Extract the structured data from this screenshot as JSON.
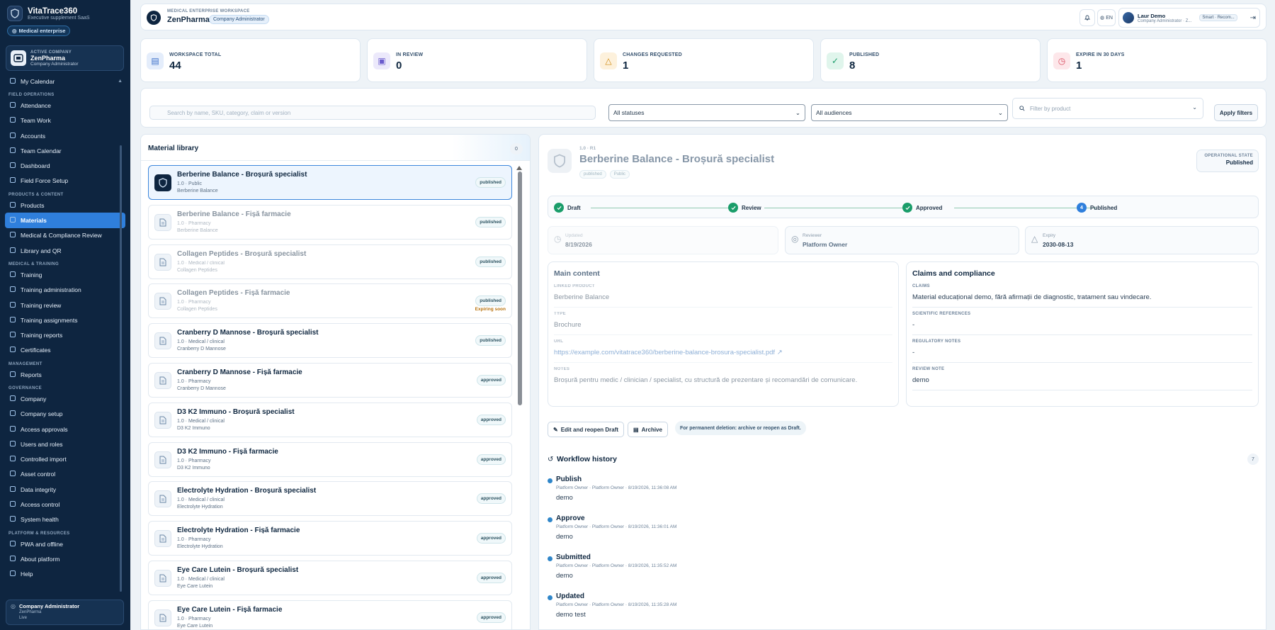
{
  "brand": {
    "name": "VitaTrace360",
    "sub": "Executive supplement SaaS",
    "tag": "Medical enterprise"
  },
  "company_card": {
    "kicker": "ACTIVE COMPANY",
    "name": "ZenPharma",
    "role": "Company Administrator"
  },
  "nav": {
    "top": [
      {
        "label": "My Calendar"
      }
    ],
    "sections": [
      {
        "title": "FIELD OPERATIONS",
        "items": [
          "Attendance",
          "Team Work",
          "Accounts",
          "Team Calendar",
          "Dashboard",
          "Field Force Setup"
        ]
      },
      {
        "title": "PRODUCTS & CONTENT",
        "items": [
          "Products",
          "Materials",
          "Medical & Compliance Review",
          "Library and QR"
        ]
      },
      {
        "title": "MEDICAL & TRAINING",
        "items": [
          "Training",
          "Training administration",
          "Training review",
          "Training assignments",
          "Training reports",
          "Certificates"
        ]
      },
      {
        "title": "MANAGEMENT",
        "items": [
          "Reports"
        ]
      },
      {
        "title": "GOVERNANCE",
        "items": [
          "Company",
          "Company setup",
          "Access approvals",
          "Users and roles",
          "Controlled import",
          "Asset control",
          "Data integrity",
          "Access control",
          "System health"
        ]
      },
      {
        "title": "PLATFORM & RESOURCES",
        "items": [
          "PWA and offline",
          "About platform",
          "Help"
        ]
      }
    ],
    "active": "Materials"
  },
  "sidebar_footer": {
    "title": "Company Administrator",
    "company": "ZenPharma",
    "status": "Live"
  },
  "topbar": {
    "kicker": "MEDICAL ENTERPRISE WORKSPACE",
    "name": "ZenPharma",
    "role": "Company Administrator",
    "lang": "EN",
    "user_name": "Laur Demo",
    "user_role": "Company Administrator · Z...",
    "user_chip": "Smart · Recom..."
  },
  "stats": [
    {
      "label": "WORKSPACE TOTAL",
      "value": "44",
      "color": "#e4edfb",
      "fg": "#3b6fc9"
    },
    {
      "label": "IN REVIEW",
      "value": "0",
      "color": "#ece9fb",
      "fg": "#6a5acd"
    },
    {
      "label": "CHANGES REQUESTED",
      "value": "1",
      "color": "#fdf1dc",
      "fg": "#d08a12"
    },
    {
      "label": "PUBLISHED",
      "value": "8",
      "color": "#e0f5ec",
      "fg": "#1a9d6a"
    },
    {
      "label": "EXPIRE IN 30 DAYS",
      "value": "1",
      "color": "#fde7ea",
      "fg": "#d84b5e"
    }
  ],
  "filters": {
    "search_placeholder": "Search by name, SKU, category, claim or version",
    "status": "All statuses",
    "audience": "All audiences",
    "product_placeholder": "Filter by product",
    "apply": "Apply filters"
  },
  "library": {
    "title": "Material library",
    "count": "0",
    "items": [
      {
        "title": "Berberine Balance - Broșură specialist",
        "meta1": "1.0 · Public",
        "meta2": "Berberine Balance",
        "status": "published",
        "selected": true
      },
      {
        "title": "Berberine Balance - Fișă farmacie",
        "meta1": "1.0 · Pharmacy",
        "meta2": "Berberine Balance",
        "status": "published",
        "faded": true
      },
      {
        "title": "Collagen Peptides - Broșură specialist",
        "meta1": "1.0 · Medical / clinical",
        "meta2": "Collagen Peptides",
        "status": "published",
        "faded": true
      },
      {
        "title": "Collagen Peptides - Fișă farmacie",
        "meta1": "1.0 · Pharmacy",
        "meta2": "Collagen Peptides",
        "status": "published",
        "warn": "Expiring soon",
        "faded": true
      },
      {
        "title": "Cranberry D Mannose - Broșură specialist",
        "meta1": "1.0 · Medical / clinical",
        "meta2": "Cranberry D Mannose",
        "status": "published"
      },
      {
        "title": "Cranberry D Mannose - Fișă farmacie",
        "meta1": "1.0 · Pharmacy",
        "meta2": "Cranberry D Mannose",
        "status": "approved"
      },
      {
        "title": "D3 K2 Immuno - Broșură specialist",
        "meta1": "1.0 · Medical / clinical",
        "meta2": "D3 K2 Immuno",
        "status": "approved"
      },
      {
        "title": "D3 K2 Immuno - Fișă farmacie",
        "meta1": "1.0 · Pharmacy",
        "meta2": "D3 K2 Immuno",
        "status": "approved"
      },
      {
        "title": "Electrolyte Hydration - Broșură specialist",
        "meta1": "1.0 · Medical / clinical",
        "meta2": "Electrolyte Hydration",
        "status": "approved"
      },
      {
        "title": "Electrolyte Hydration - Fișă farmacie",
        "meta1": "1.0 · Pharmacy",
        "meta2": "Electrolyte Hydration",
        "status": "approved"
      },
      {
        "title": "Eye Care Lutein - Broșură specialist",
        "meta1": "1.0 · Medical / clinical",
        "meta2": "Eye Care Lutein",
        "status": "approved"
      },
      {
        "title": "Eye Care Lutein - Fișă farmacie",
        "meta1": "1.0 · Pharmacy",
        "meta2": "Eye Care Lutein",
        "status": "approved"
      }
    ]
  },
  "detail": {
    "version": "1.0 · R1",
    "title": "Berberine Balance - Broșură specialist",
    "pills": [
      "published",
      "Public"
    ],
    "opstate_label": "OPERATIONAL STATE",
    "opstate_value": "Published",
    "steps": [
      {
        "label": "Draft"
      },
      {
        "label": "Review"
      },
      {
        "label": "Approved"
      },
      {
        "label": "Published",
        "num": "4"
      }
    ],
    "updated_label": "Updated",
    "updated_value": "8/19/2026",
    "reviewer_label": "Reviewer",
    "reviewer_value": "Platform Owner",
    "expiry_label": "Expiry",
    "expiry_value": "2030-08-13",
    "main": {
      "title": "Main content",
      "linked_k": "LINKED PRODUCT",
      "linked_v": "Berberine Balance",
      "type_k": "TYPE",
      "type_v": "Brochure",
      "url_k": "URL",
      "url_v": "https://example.com/vitatrace360/berberine-balance-brosura-specialist.pdf",
      "notes_k": "NOTES",
      "notes_v": "Broșură pentru medic / clinician / specialist, cu structură de prezentare și recomandări de comunicare."
    },
    "claims": {
      "title": "Claims and compliance",
      "claims_k": "CLAIMS",
      "claims_v": "Material educațional demo, fără afirmații de diagnostic, tratament sau vindecare.",
      "sci_k": "SCIENTIFIC REFERENCES",
      "sci_v": "-",
      "reg_k": "REGULATORY NOTES",
      "reg_v": "-",
      "rev_k": "REVIEW NOTE",
      "rev_v": "demo"
    },
    "actions": {
      "edit": "Edit and reopen Draft",
      "archive": "Archive",
      "note": "For permanent deletion: archive or reopen as Draft."
    },
    "workflow": {
      "title": "Workflow history",
      "count": "7",
      "items": [
        {
          "action": "Publish",
          "meta": "Platform Owner · Platform Owner · 8/19/2026, 11:36:08 AM",
          "note": "demo"
        },
        {
          "action": "Approve",
          "meta": "Platform Owner · Platform Owner · 8/19/2026, 11:36:01 AM",
          "note": "demo"
        },
        {
          "action": "Submitted",
          "meta": "Platform Owner · Platform Owner · 8/19/2026, 11:35:52 AM",
          "note": "demo"
        },
        {
          "action": "Updated",
          "meta": "Platform Owner · Platform Owner · 8/19/2026, 11:35:28 AM",
          "note": "demo test"
        }
      ]
    }
  }
}
